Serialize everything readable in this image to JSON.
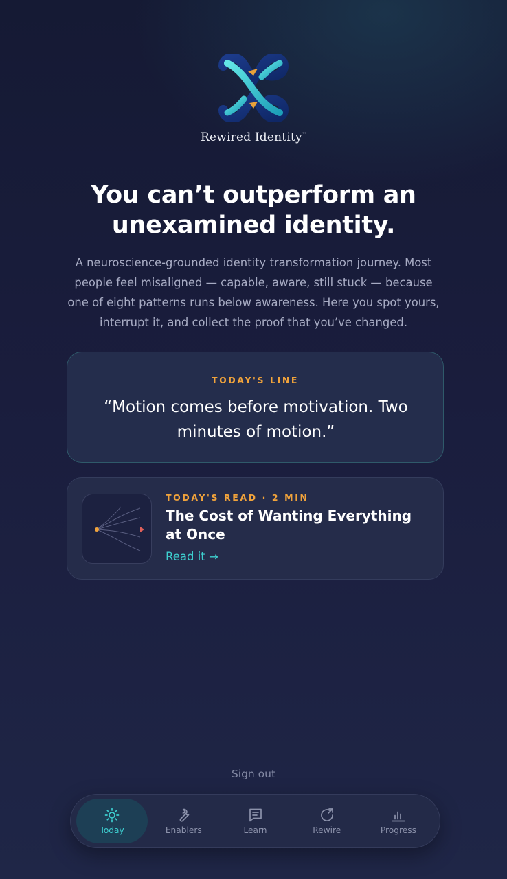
{
  "brand": {
    "name": "Rewired Identity",
    "trademark": "™"
  },
  "hero": {
    "headline": "You can’t outperform an unexamined identity.",
    "intro": "A neuroscience-grounded identity transformation journey. Most people feel misaligned — capable, aware, still stuck — because one of eight patterns runs below awareness. Here you spot yours, interrupt it, and collect the proof that you’ve changed."
  },
  "todays_line": {
    "eyebrow": "TODAY'S LINE",
    "quote": "“Motion comes before motivation. Two minutes of motion.”"
  },
  "todays_read": {
    "eyebrow": "TODAY'S READ · 2 MIN",
    "title": "The Cost of Wanting Everything at Once",
    "link_label": "Read it →"
  },
  "footer": {
    "sign_out": "Sign out"
  },
  "tabs": [
    {
      "label": "Today",
      "icon": "sun-icon",
      "active": true
    },
    {
      "label": "Enablers",
      "icon": "wrench-icon",
      "active": false
    },
    {
      "label": "Learn",
      "icon": "note-icon",
      "active": false
    },
    {
      "label": "Rewire",
      "icon": "rotate-arrow-icon",
      "active": false
    },
    {
      "label": "Progress",
      "icon": "bar-chart-icon",
      "active": false
    }
  ],
  "colors": {
    "accent_teal": "#3ecfd0",
    "accent_orange": "#f1a33b",
    "background": "#1a1d3d"
  }
}
